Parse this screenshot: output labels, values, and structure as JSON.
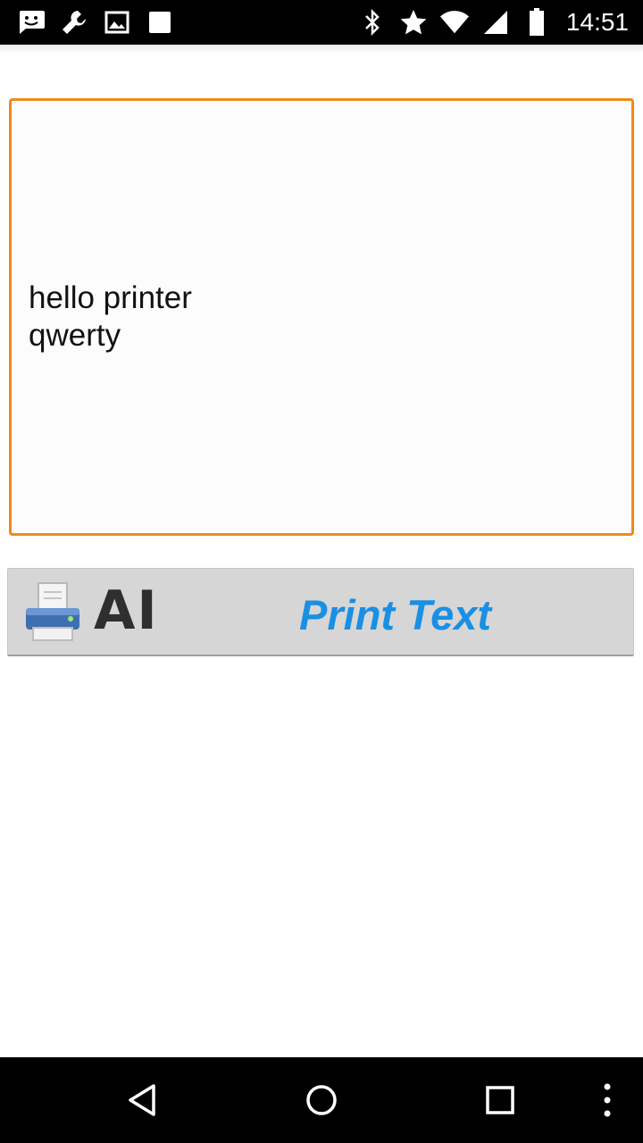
{
  "status_bar": {
    "time": "14:51",
    "left_icons": [
      "messaging-icon",
      "wrench-icon",
      "image-icon",
      "square-icon"
    ],
    "right_icons": [
      "bluetooth-icon",
      "star-icon",
      "wifi-icon",
      "signal-icon",
      "battery-icon"
    ]
  },
  "text_input": {
    "lines": [
      "hello printer",
      "qwerty"
    ],
    "border_color": "#f08a1c"
  },
  "print_button": {
    "icon_text": "AI",
    "label": "Print Text",
    "label_color": "#1a8fe3"
  },
  "nav_bar": {
    "buttons": [
      "back-icon",
      "home-icon",
      "recents-icon",
      "more-icon"
    ]
  }
}
